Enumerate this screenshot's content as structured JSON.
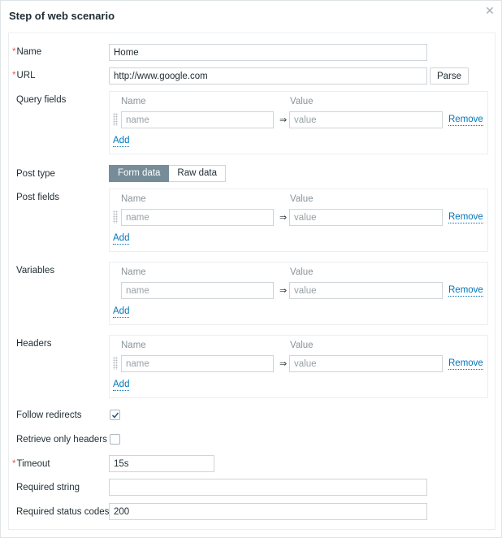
{
  "dialog": {
    "title": "Step of web scenario",
    "close_icon": "close-icon"
  },
  "form": {
    "name": {
      "label": "Name",
      "required": true,
      "value": "Home"
    },
    "url": {
      "label": "URL",
      "required": true,
      "value": "http://www.google.com",
      "parse_button": "Parse"
    },
    "query_fields": {
      "label": "Query fields",
      "col_name": "Name",
      "col_value": "Value",
      "rows": [
        {
          "name_placeholder": "name",
          "value_placeholder": "value",
          "remove": "Remove",
          "draggable": true
        }
      ],
      "add": "Add"
    },
    "post_type": {
      "label": "Post type",
      "options": [
        "Form data",
        "Raw data"
      ],
      "selected": "Form data"
    },
    "post_fields": {
      "label": "Post fields",
      "col_name": "Name",
      "col_value": "Value",
      "rows": [
        {
          "name_placeholder": "name",
          "value_placeholder": "value",
          "remove": "Remove",
          "draggable": true
        }
      ],
      "add": "Add"
    },
    "variables": {
      "label": "Variables",
      "col_name": "Name",
      "col_value": "Value",
      "rows": [
        {
          "name_placeholder": "name",
          "value_placeholder": "value",
          "remove": "Remove",
          "draggable": false
        }
      ],
      "add": "Add"
    },
    "headers": {
      "label": "Headers",
      "col_name": "Name",
      "col_value": "Value",
      "rows": [
        {
          "name_placeholder": "name",
          "value_placeholder": "value",
          "remove": "Remove",
          "draggable": true
        }
      ],
      "add": "Add"
    },
    "follow_redirects": {
      "label": "Follow redirects",
      "checked": true
    },
    "retrieve_only_headers": {
      "label": "Retrieve only headers",
      "checked": false
    },
    "timeout": {
      "label": "Timeout",
      "required": true,
      "value": "15s"
    },
    "required_string": {
      "label": "Required string",
      "value": ""
    },
    "required_status_codes": {
      "label": "Required status codes",
      "value": "200"
    }
  },
  "colors": {
    "accent_link": "#0275b8",
    "required_asterisk": "#e45959",
    "segment_active": "#768d99"
  }
}
